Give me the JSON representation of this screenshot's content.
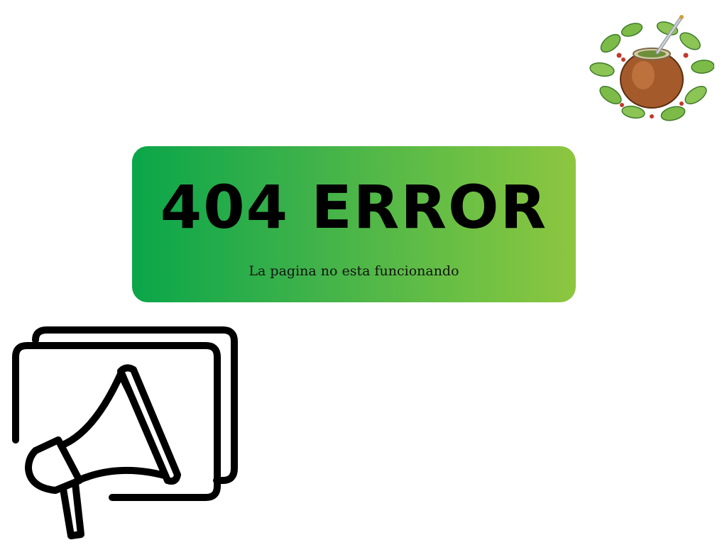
{
  "error": {
    "title": "404 ERROR",
    "subtitle": "La pagina no esta funcionando"
  },
  "icons": {
    "top_right": "mate-gourd-illustration",
    "bottom_left": "megaphone-icon"
  },
  "colors": {
    "banner_gradient_start": "#0aa64a",
    "banner_gradient_end": "#8dc63f",
    "text": "#000000",
    "background": "#ffffff"
  }
}
